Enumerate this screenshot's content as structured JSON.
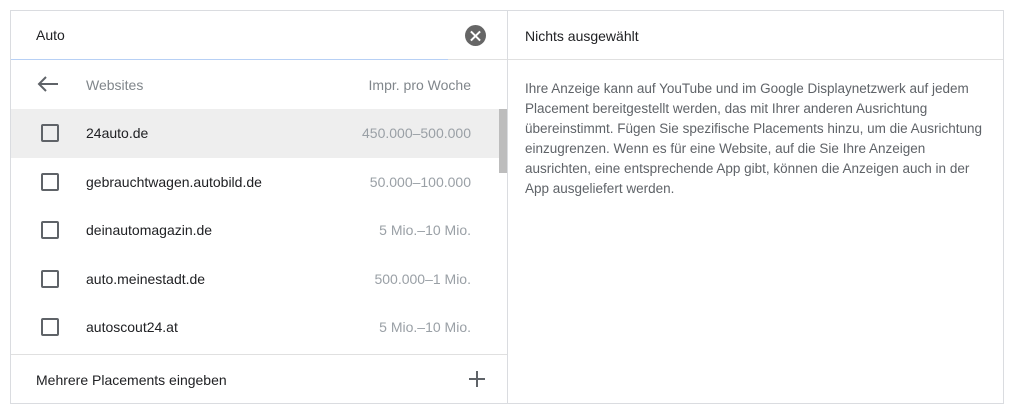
{
  "search": {
    "value": "Auto",
    "clear_icon": "close-circle-icon"
  },
  "columns": {
    "back_icon": "arrow-back-icon",
    "label": "Websites",
    "metric": "Impr. pro Woche"
  },
  "rows": [
    {
      "site": "24auto.de",
      "impressions": "450.000–500.000",
      "selected": true
    },
    {
      "site": "gebrauchtwagen.autobild.de",
      "impressions": "50.000–100.000",
      "selected": false
    },
    {
      "site": "deinautomagazin.de",
      "impressions": "5 Mio.–10 Mio.",
      "selected": false
    },
    {
      "site": "auto.meinestadt.de",
      "impressions": "500.000–1 Mio.",
      "selected": false
    },
    {
      "site": "autoscout24.at",
      "impressions": "5 Mio.–10 Mio.",
      "selected": false
    }
  ],
  "footer": {
    "label": "Mehrere Placements eingeben",
    "icon": "plus-icon"
  },
  "selection_panel": {
    "title": "Nichts ausgewählt",
    "description": "Ihre Anzeige kann auf YouTube und im Google Displaynetzwerk auf jedem Placement bereitgestellt werden, das mit Ihrer anderen Ausrichtung übereinstimmt. Fügen Sie spezifische Placements hinzu, um die Ausrichtung einzugrenzen. Wenn es für eine Website, auf die Sie Ihre Anzeigen ausrichten, eine entsprechende App gibt, können die Anzeigen auch in der App ausgeliefert werden."
  },
  "colors": {
    "accent_underline": "#b7d0f5",
    "selected_row": "#eeeeee",
    "muted_text": "#9aa0a6"
  }
}
